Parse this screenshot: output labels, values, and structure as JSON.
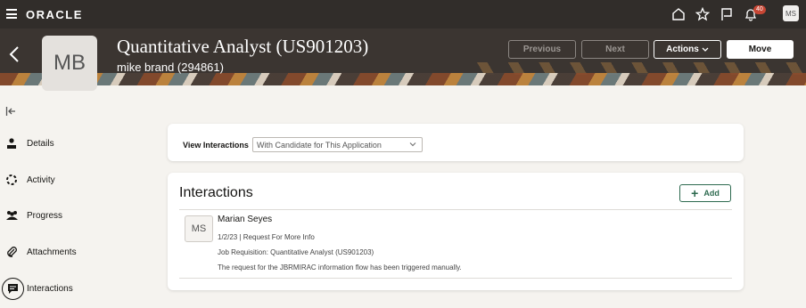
{
  "header": {
    "logo": "ORACLE",
    "notification_count": "40",
    "user_initials": "MS"
  },
  "hero": {
    "initials": "MB",
    "title": "Quantitative Analyst (US901203)",
    "subtitle": "mike brand (294861)",
    "buttons": {
      "previous": "Previous",
      "next": "Next",
      "actions": "Actions",
      "move": "Move"
    }
  },
  "nav": {
    "items": [
      {
        "label": "Details"
      },
      {
        "label": "Activity"
      },
      {
        "label": "Progress"
      },
      {
        "label": "Attachments"
      },
      {
        "label": "Interactions"
      }
    ]
  },
  "view_interactions": {
    "label": "View Interactions",
    "selected": "With Candidate for This Application"
  },
  "interactions": {
    "title": "Interactions",
    "add_label": "Add",
    "entries": [
      {
        "initials": "MS",
        "name": "Marian Seyes",
        "date_type": "1/2/23 | Request For More Info",
        "requisition": "Job Requisition: Quantitative Analyst (US901203)",
        "message": "The request for the JBRMIRAC information flow has been triggered manually."
      }
    ]
  },
  "colors": {
    "header_bg": "#312d2a",
    "accent_green": "#2d6a4f",
    "badge_red": "#c74634"
  }
}
